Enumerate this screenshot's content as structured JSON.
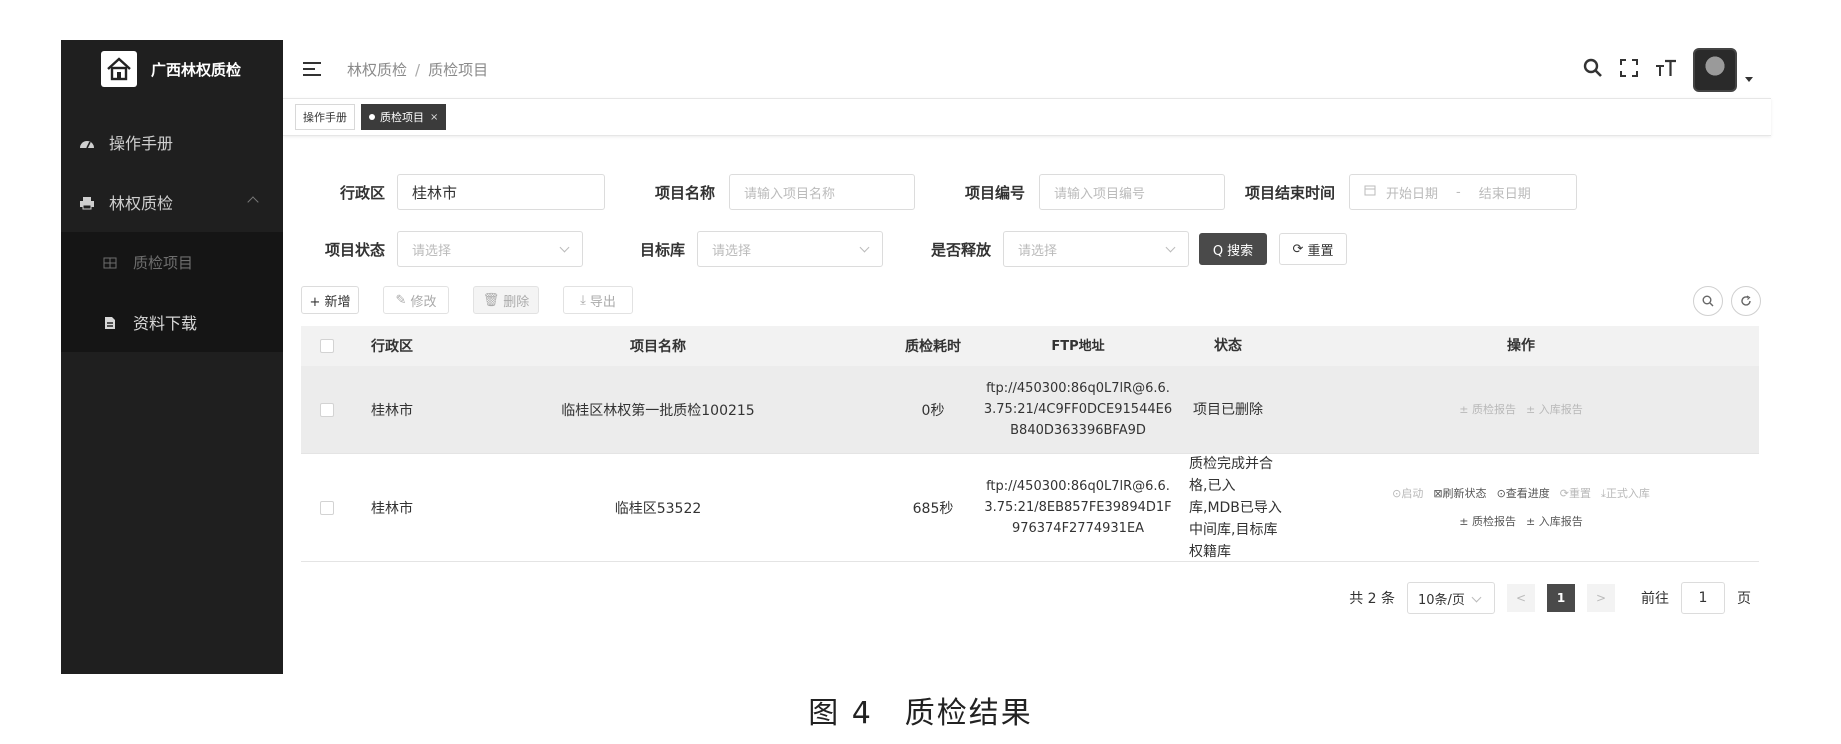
{
  "app": {
    "title": "广西林权质检"
  },
  "sidebar": {
    "items": [
      {
        "label": "操作手册"
      },
      {
        "label": "林权质检"
      },
      {
        "label": "质检项目"
      },
      {
        "label": "资料下载"
      }
    ]
  },
  "breadcrumb": {
    "root": "林权质检",
    "sep": "/",
    "current": "质检项目"
  },
  "tags": [
    {
      "label": "操作手册"
    },
    {
      "label": "质检项目",
      "close": "×"
    }
  ],
  "search": {
    "district": {
      "label": "行政区",
      "value": "桂林市"
    },
    "project_name": {
      "label": "项目名称",
      "placeholder": "请输入项目名称"
    },
    "project_code": {
      "label": "项目编号",
      "placeholder": "请输入项目编号"
    },
    "end_time": {
      "label": "项目结束时间",
      "start_placeholder": "开始日期",
      "range_sep": "-",
      "end_placeholder": "结束日期"
    },
    "status": {
      "label": "项目状态",
      "placeholder": "请选择"
    },
    "target": {
      "label": "目标库",
      "placeholder": "请选择"
    },
    "released": {
      "label": "是否释放",
      "placeholder": "请选择"
    },
    "search_button": "Q 搜索",
    "reset_button": "重置"
  },
  "toolbar": {
    "add": "+ 新增",
    "edit": "修改",
    "delete": "删除",
    "export": "导出"
  },
  "table": {
    "headers": [
      "行政区",
      "项目名称",
      "质检耗时",
      "FTP地址",
      "状态",
      "操作"
    ],
    "rows": [
      {
        "district": "桂林市",
        "name": "临桂区林权第一批质检100215",
        "time": "0秒",
        "ftp": "ftp://450300:86q0L7lR@6.6.3.75:21/4C9FF0DCE91544E6B840D363396BFA9D",
        "status": "项目已删除",
        "ops_line1": [],
        "ops_line2": [
          "± 质检报告",
          "± 入库报告"
        ]
      },
      {
        "district": "桂林市",
        "name": "临桂区53522",
        "time": "685秒",
        "ftp": "ftp://450300:86q0L7lR@6.6.3.75:21/8EB857FE39894D1F976374F2774931EA",
        "status": "质检完成并合格,已入库,MDB已导入中间库,目标库权籍库",
        "ops_line1": [
          "⊙启动",
          "⊠刷新状态",
          "⊙查看进度",
          "⟳重置",
          "⤓正式入库"
        ],
        "ops_line2": [
          "± 质检报告",
          "± 入库报告"
        ]
      }
    ]
  },
  "pagination": {
    "total": "共 2 条",
    "page_size": "10条/页",
    "prev": "<",
    "current": "1",
    "next": ">",
    "goto_label": "前往",
    "goto_value": "1",
    "page_suffix": "页"
  },
  "caption": "图 4　质检结果"
}
